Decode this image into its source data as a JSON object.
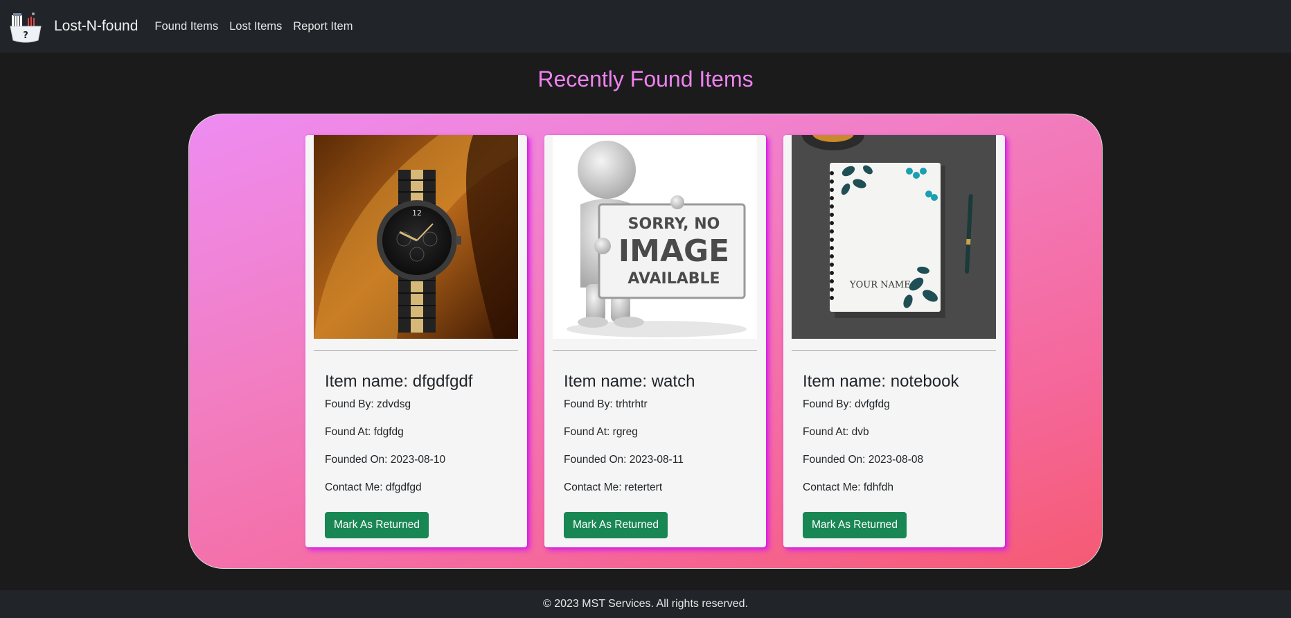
{
  "navbar": {
    "brand": "Lost-N-found",
    "links": [
      "Found Items",
      "Lost Items",
      "Report Item"
    ]
  },
  "page_title": "Recently Found Items",
  "cards": [
    {
      "image": "watch-photo",
      "item_name": "Item name: dfgdfgdf",
      "found_by": "Found By: zdvdsg",
      "found_at": "Found At: fdgfdg",
      "founded_on": "Founded On: 2023-08-10",
      "contact": "Contact Me: dfgdfgd",
      "button": "Mark As Returned"
    },
    {
      "image": "sorry-no-image-placeholder",
      "image_text": [
        "SORRY, NO",
        "IMAGE",
        "AVAILABLE"
      ],
      "item_name": "Item name: watch",
      "found_by": "Found By: trhtrhtr",
      "found_at": "Found At: rgreg",
      "founded_on": "Founded On: 2023-08-11",
      "contact": "Contact Me: retertert",
      "button": "Mark As Returned"
    },
    {
      "image": "notebook-photo",
      "image_text": "YOUR NAME",
      "item_name": "Item name: notebook",
      "found_by": "Found By: dvfgfdg",
      "found_at": "Found At: dvb",
      "founded_on": "Founded On: 2023-08-08",
      "contact": "Contact Me: fdhfdh",
      "button": "Mark As Returned"
    }
  ],
  "footer": "© 2023 MST Services. All rights reserved.",
  "colors": {
    "navbar_bg": "#212529",
    "page_bg": "#1b1b1c",
    "title": "#ee82ee",
    "button": "#198754",
    "card_shadow": "#d81fe6"
  }
}
